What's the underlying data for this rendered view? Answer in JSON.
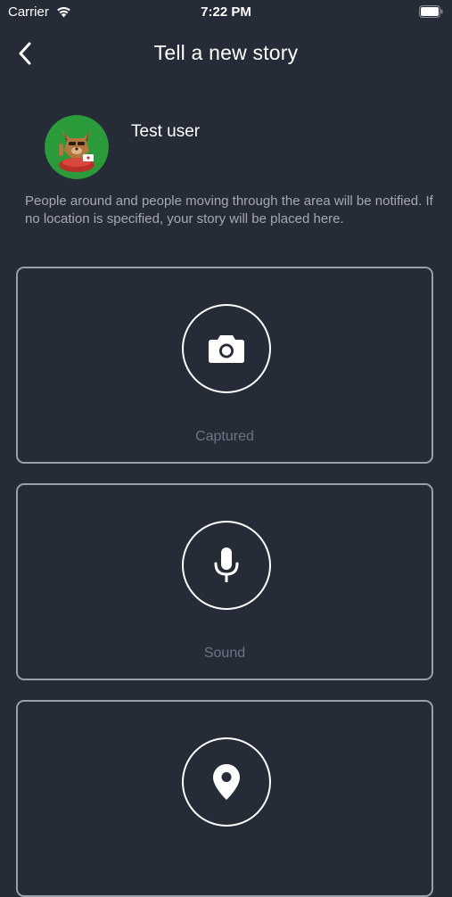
{
  "status_bar": {
    "carrier": "Carrier",
    "time": "7:22 PM"
  },
  "nav": {
    "title": "Tell a new story"
  },
  "user": {
    "name": "Test user"
  },
  "info": {
    "text": "People around and people moving through the area will be notified. If no location is specified, your story will be placed here."
  },
  "cards": [
    {
      "label": "Captured",
      "icon": "camera-icon"
    },
    {
      "label": "Sound",
      "icon": "microphone-icon"
    },
    {
      "label": "",
      "icon": "location-pin-icon"
    }
  ],
  "colors": {
    "background": "#252b37",
    "card_border": "#9aa0aa",
    "muted_text": "#a4a9b2",
    "label_text": "#6e7481",
    "avatar_bg": "#2a9a3a"
  }
}
